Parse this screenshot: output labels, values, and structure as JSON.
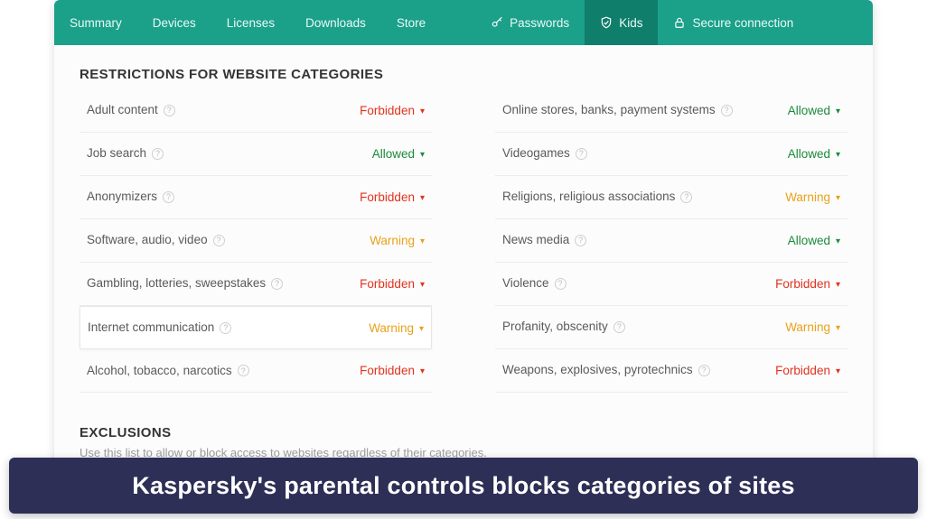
{
  "nav": {
    "items": [
      {
        "label": "Summary"
      },
      {
        "label": "Devices"
      },
      {
        "label": "Licenses"
      },
      {
        "label": "Downloads"
      },
      {
        "label": "Store"
      }
    ],
    "iconed": [
      {
        "label": "Passwords",
        "icon": "key-icon"
      },
      {
        "label": "Kids",
        "icon": "shield-icon",
        "active": true
      },
      {
        "label": "Secure connection",
        "icon": "lock-icon"
      }
    ]
  },
  "restrictions": {
    "title": "RESTRICTIONS FOR WEBSITE CATEGORIES",
    "status_labels": {
      "forbidden": "Forbidden",
      "allowed": "Allowed",
      "warning": "Warning"
    },
    "left": [
      {
        "label": "Adult content",
        "status": "forbidden"
      },
      {
        "label": "Job search",
        "status": "allowed"
      },
      {
        "label": "Anonymizers",
        "status": "forbidden"
      },
      {
        "label": "Software, audio, video",
        "status": "warning"
      },
      {
        "label": "Gambling, lotteries, sweepstakes",
        "status": "forbidden"
      },
      {
        "label": "Internet communication",
        "status": "warning",
        "highlight": true
      },
      {
        "label": "Alcohol, tobacco, narcotics",
        "status": "forbidden"
      }
    ],
    "right": [
      {
        "label": "Online stores, banks, payment systems",
        "status": "allowed"
      },
      {
        "label": "Videogames",
        "status": "allowed"
      },
      {
        "label": "Religions, religious associations",
        "status": "warning"
      },
      {
        "label": "News media",
        "status": "allowed"
      },
      {
        "label": "Violence",
        "status": "forbidden"
      },
      {
        "label": "Profanity, obscenity",
        "status": "warning"
      },
      {
        "label": "Weapons, explosives, pyrotechnics",
        "status": "forbidden"
      }
    ]
  },
  "exclusions": {
    "title": "EXCLUSIONS",
    "desc": "Use this list to allow or block access to websites regardless of their categories."
  },
  "caption": "Kaspersky's parental controls blocks categories of sites"
}
